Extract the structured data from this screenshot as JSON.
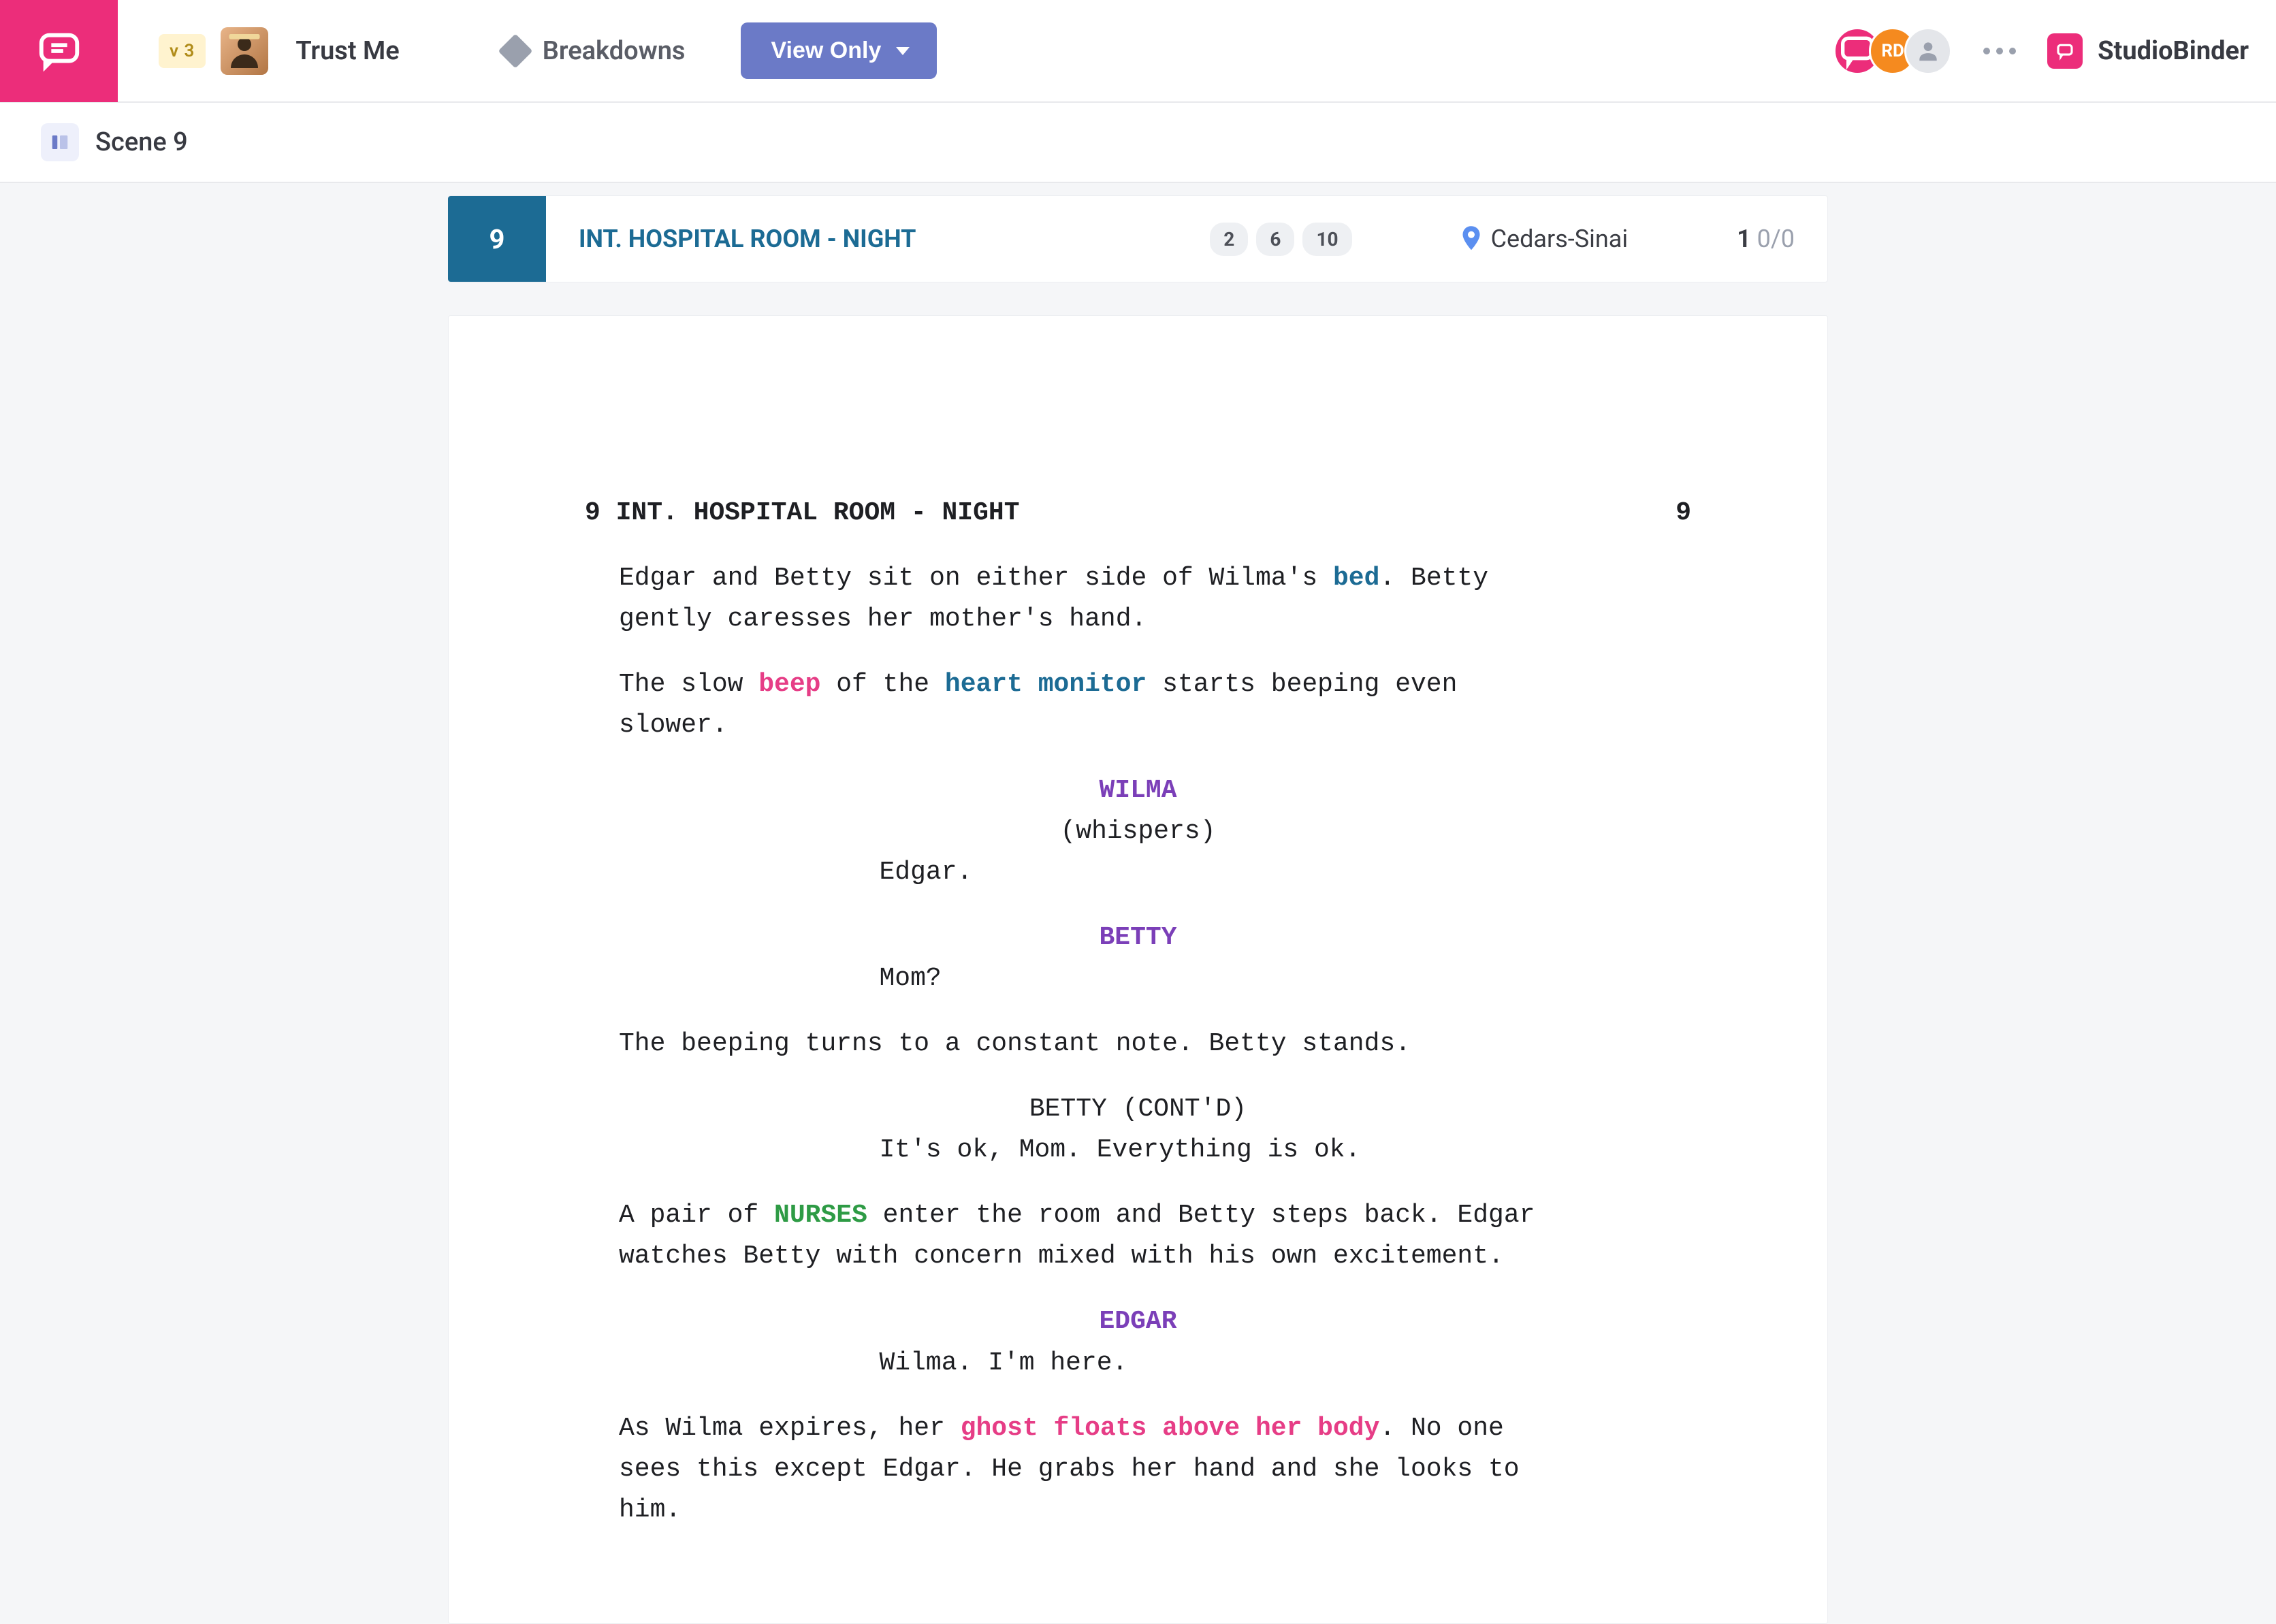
{
  "toolbar": {
    "version_badge": "v 3",
    "project_title": "Trust Me",
    "breakdowns_label": "Breakdowns",
    "view_only_label": "View Only",
    "avatars": {
      "second_initials": "RD"
    },
    "brand_name": "StudioBinder"
  },
  "subbar": {
    "scene_label": "Scene 9"
  },
  "scene_header": {
    "number": "9",
    "slugline": "INT. HOSPITAL ROOM - NIGHT",
    "pills": [
      "2",
      "6",
      "10"
    ],
    "location": "Cedars-Sinai",
    "pages_main": "1",
    "pages_sub": "0/0"
  },
  "script": {
    "num_left": "9",
    "slug": "INT. HOSPITAL ROOM - NIGHT",
    "num_right": "9",
    "a1_p1": "Edgar and Betty sit on either side of Wilma's ",
    "a1_tag": "bed",
    "a1_p2": ". Betty gently caresses her mother's hand.",
    "a2_p1": "The slow ",
    "a2_tag1": "beep",
    "a2_p2": " of the ",
    "a2_tag2": "heart monitor",
    "a2_p3": " starts beeping even slower.",
    "c1": "WILMA",
    "p1": "(whispers)",
    "d1": "Edgar.",
    "c2": "BETTY",
    "d2": "Mom?",
    "a3": "The beeping turns to a constant note. Betty stands.",
    "c3": "BETTY (CONT'D)",
    "d3": "It's ok, Mom. Everything is ok.",
    "a4_p1": "A pair of ",
    "a4_tag": "NURSES",
    "a4_p2": " enter the room and Betty steps back. Edgar watches Betty with concern mixed with his own excitement.",
    "c4": "EDGAR",
    "d4": "Wilma. I'm here.",
    "a5_p1": "As Wilma expires, her ",
    "a5_tag": "ghost floats above her body",
    "a5_p2": ". No one sees this except Edgar. He grabs her hand and she looks to him."
  }
}
